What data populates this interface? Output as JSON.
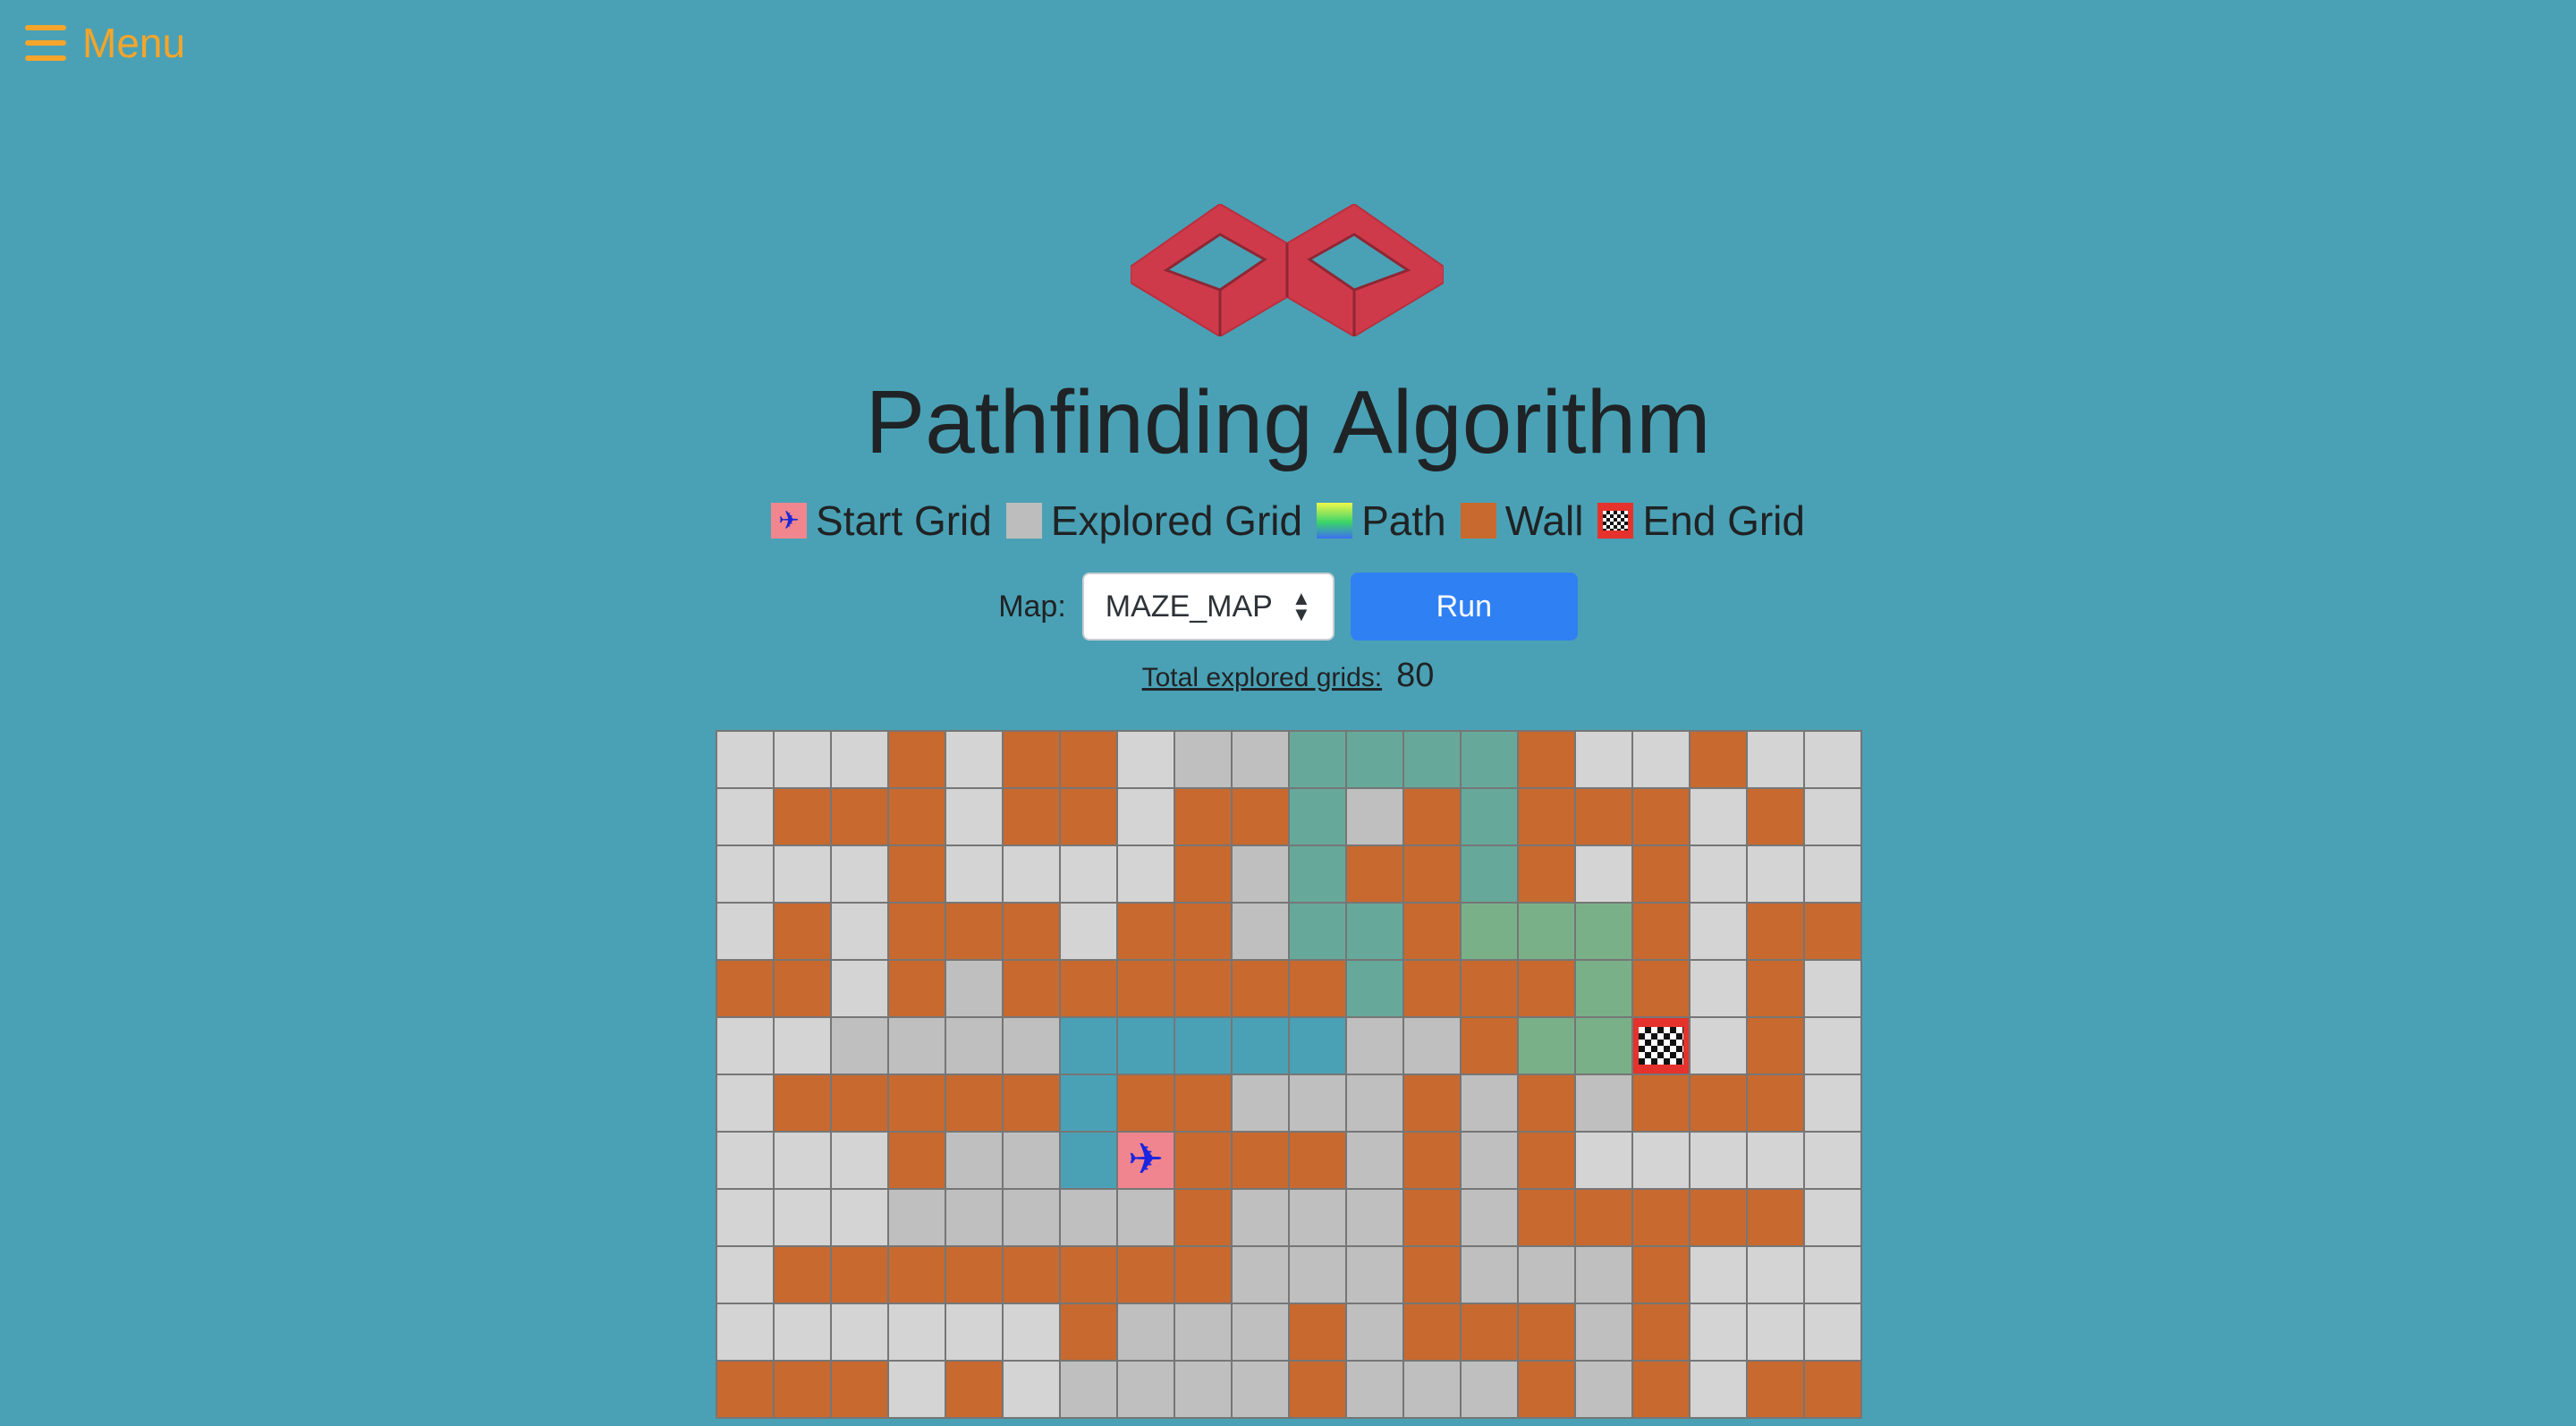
{
  "menu": {
    "label": "Menu"
  },
  "title": "Pathfinding Algorithm",
  "legend": [
    {
      "label": "Start Grid",
      "type": "start"
    },
    {
      "label": "Explored Grid",
      "type": "explored"
    },
    {
      "label": "Path",
      "type": "path"
    },
    {
      "label": "Wall",
      "type": "wall"
    },
    {
      "label": "End Grid",
      "type": "end"
    }
  ],
  "controls": {
    "map_label": "Map:",
    "map_value": "MAZE_MAP",
    "run_label": "Run"
  },
  "stats": {
    "label": "Total explored grids:",
    "value": "80"
  },
  "colors": {
    "background": "#4aa1b5",
    "menu": "#f5a52a",
    "logo": "#cf3a4a",
    "wall": "#c8692f",
    "explored": "#bfbfbf",
    "unexplored": "#d4d4d4",
    "run_button": "#2f80f3"
  },
  "grid": {
    "legend_codes": {
      ".": "unexplored",
      "e": "explored",
      "W": "wall",
      "1": "path",
      "2": "path",
      "3": "path",
      "S": "start",
      "G": "end"
    },
    "rows": [
      "...W.WW.ee2222W..W.",
      ".WWW.WW.WW2eW2WWW.W.",
      "...W....We2WW2W.W...",
      ".W.WWW.WWe22W333W.WW",
      "WW.WeWWWWWW2WWW3W.W.",
      "..eeee11111eeW33G.W.",
      ".WWWWW1WWeeeWeWeWWW.",
      "...Wee1SWWWeWeW.....",
      "...eeeeeWeeeWeWWWWW.",
      ".WWWWWWWWeeeWeeeW...",
      "......WeeeWeWWWeW...",
      "WWW.W.eeeeWeeeWeW.WW"
    ]
  }
}
